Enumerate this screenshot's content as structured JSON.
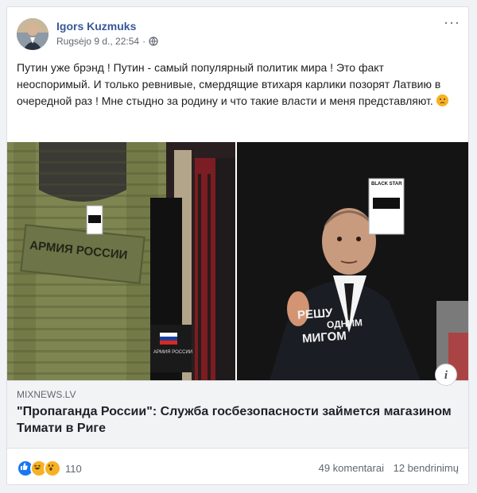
{
  "post": {
    "author": "Igors Kuzmuks",
    "timestamp": "Rugsėjo 9 d., 22:54",
    "separator": "·",
    "privacy_icon": "globe-icon",
    "more_icon": "more-options-icon",
    "body_text": "Путин уже брэнд ! Путин - самый популярный политик мира ! Это факт неоспоримый. И только ревнивые, смердящие втихаря карлики позорят Латвию в очередной раз ! Мне стыдно за родину и что такие власти и меня представляют. "
  },
  "media": {
    "left_photo": {
      "vest_patch": "АРМИЯ РОССИИ",
      "small_tag": "АРМИЯ РОССИИ",
      "flag_colors": [
        "#ffffff",
        "#1c3fa0",
        "#d52b1e"
      ]
    },
    "right_photo": {
      "shirt_caption_line1": "РЕШУ",
      "shirt_caption_line2": "ОДНИМ",
      "shirt_caption_line3": "МИГОМ",
      "price_tag_brand": "BLACK STAR"
    }
  },
  "link_preview": {
    "domain": "MIXNEWS.LV",
    "headline": "\"Пропаганда России\": Служба госбезопасности займется магазином Тимати в Риге",
    "info_label": "i"
  },
  "footer": {
    "reaction_icons": [
      "like-icon",
      "haha-icon",
      "wow-icon"
    ],
    "reaction_count": "110",
    "comments": "49 komentarai",
    "shares": "12 bendrinimų"
  },
  "colors": {
    "author_link": "#385898",
    "like_blue": "#1877f2",
    "emoji_yellow": "#f7b125"
  }
}
